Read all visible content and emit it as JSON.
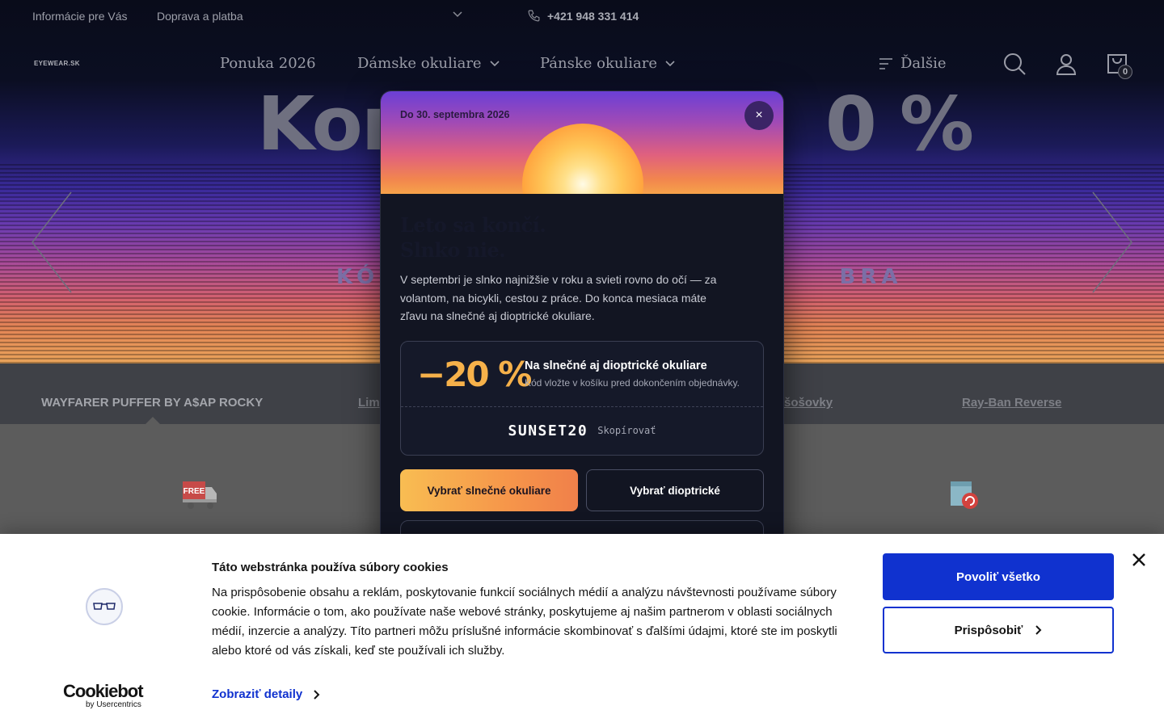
{
  "topbar": {
    "info_link": "Informácie pre Vás",
    "shipping_link": "Doprava a platba",
    "phone": "+421 948 331 414"
  },
  "nav": {
    "logo": "EYEWEAR.SK",
    "offer": "Ponuka 2026",
    "women": "Dámske okuliare",
    "men": "Pánske okuliare",
    "more": "Ďalšie",
    "cart_count": "0"
  },
  "hero": {
    "title": "Kon                 0 %",
    "subtitle": "KÓD                                    BRA"
  },
  "tabs": [
    {
      "label": "WAYFARER PUFFER BY A$AP ROCKY",
      "active": true
    },
    {
      "label": "Lim",
      "active": false
    },
    {
      "label": "šošovky",
      "active": false
    },
    {
      "label": "Ray-Ban Reverse",
      "active": false
    }
  ],
  "benefits": {
    "free_icon_text": "FREE"
  },
  "promo": {
    "date": "Do 30. septembra 2026",
    "close": "×",
    "title_line1": "Leto sa končí.",
    "title_line2": "Slnko nie.",
    "text": "V septembri je slnko najnižšie v roku a svieti rovno do očí — za volantom, na bicykli, cestou z práce. Do konca mesiaca máte zľavu na slnečné aj dioptrické okuliare.",
    "discount": "−20 %",
    "headline": "Na slnečné aj dioptrické okuliare",
    "note": "Kód vložte v košíku pred dokončením objednávky.",
    "code": "SUNSET20",
    "copy": "Skopírovať",
    "btn_sun": "Vybrať slnečné okuliare",
    "btn_dio": "Vybrať dioptrické"
  },
  "cookie": {
    "title": "Táto webstránka používa súbory cookies",
    "text": "Na prispôsobenie obsahu a reklám, poskytovanie funkcií sociálnych médií a analýzu návštevnosti používame súbory cookie. Informácie o tom, ako používate naše webové stránky, poskytujeme aj našim partnerom v oblasti sociálnych médií, inzercie a analýzy. Títo partneri môžu príslušné informácie skombinovať s ďalšími údajmi, ktoré ste im poskytli alebo ktoré od vás získali, keď ste používali ich služby.",
    "details": "Zobraziť detaily",
    "allow_all": "Povoliť všetko",
    "customize": "Prispôsobiť",
    "brand": "Cookiebot",
    "brand_sub": "by Usercentrics"
  },
  "colors": {
    "accent_orange": "#f6b14a",
    "cookie_blue": "#1032cf",
    "modal_bg": "#121522"
  }
}
